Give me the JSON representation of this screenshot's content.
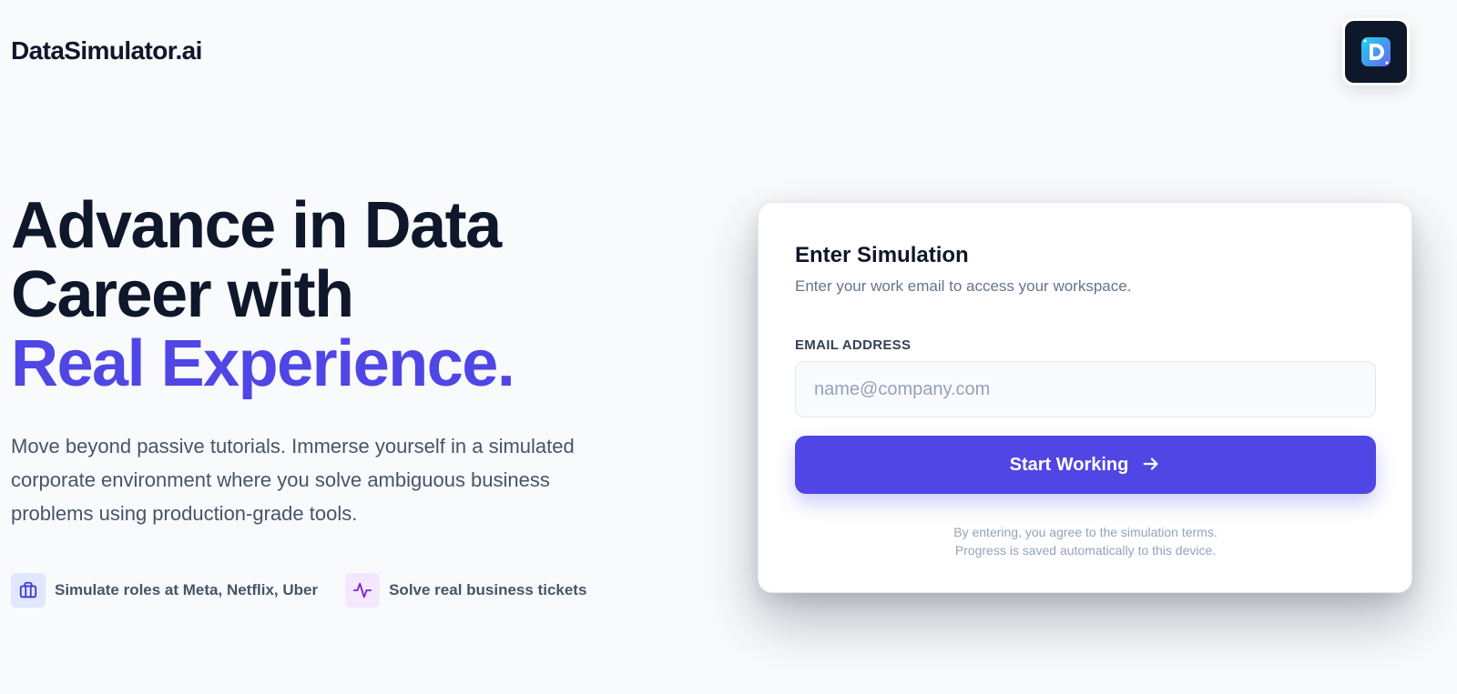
{
  "header": {
    "brand": "DataSimulator.ai",
    "logo_icon": "datasimulator-d-logo-icon"
  },
  "hero": {
    "title_line1": "Advance in Data",
    "title_line2": "Career with",
    "title_accent": "Real Experience.",
    "description": "Move beyond passive tutorials. Immerse yourself in a simulated corporate environment where you solve ambiguous business problems using production-grade tools.",
    "features": [
      {
        "icon": "briefcase-icon",
        "label": "Simulate roles at Meta, Netflix, Uber"
      },
      {
        "icon": "activity-icon",
        "label": "Solve real business tickets"
      }
    ]
  },
  "form": {
    "title": "Enter Simulation",
    "subtitle": "Enter your work email to access your workspace.",
    "email_label": "EMAIL ADDRESS",
    "email_placeholder": "name@company.com",
    "email_value": "",
    "submit_label": "Start Working",
    "submit_icon": "arrow-right-icon",
    "terms_line1": "By entering, you agree to the simulation terms.",
    "terms_line2": "Progress is saved automatically to this device."
  },
  "colors": {
    "accent": "#4f46e5",
    "text_dark": "#0f172a",
    "text_muted": "#475569",
    "background": "#f8fafc"
  }
}
